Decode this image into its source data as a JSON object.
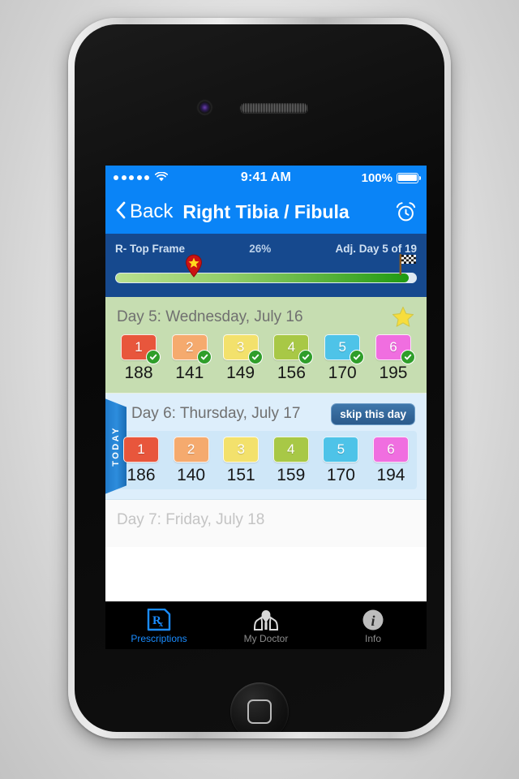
{
  "status_bar": {
    "signal_dots": 5,
    "wifi_icon": "wifi-icon",
    "time": "9:41 AM",
    "battery_percent": "100%",
    "battery_icon": "battery-full-icon"
  },
  "nav_bar": {
    "back_icon": "chevron-left-icon",
    "back_label": "Back",
    "title": "Right Tibia / Fibula",
    "alarm_icon": "alarm-clock-icon"
  },
  "progress": {
    "frame_label": "R- Top Frame",
    "percent": "26%",
    "day_label": "Adj. Day 5 of 19",
    "percent_value": 26,
    "pin_icon": "map-pin-star-icon",
    "finish_icon": "checkered-flag-icon",
    "track_color": "#dfe9f2",
    "fill_start_color": "#b9e08f",
    "fill_end_color": "#1f9a12",
    "panel_color": "#16498e"
  },
  "strut_colors": [
    "#e8563c",
    "#f5aa6e",
    "#f3e16c",
    "#a8c846",
    "#4ec3e8",
    "#f06ee0"
  ],
  "strut_labels": [
    "1",
    "2",
    "3",
    "4",
    "5",
    "6"
  ],
  "days": [
    {
      "title": "Day 5: Wednesday, July 16",
      "state": "done",
      "badge_icon": "star-icon",
      "values": [
        "188",
        "141",
        "149",
        "156",
        "170",
        "195"
      ],
      "checked": true,
      "background": "#c6ddb1"
    },
    {
      "title": "Day 6: Thursday, July 17",
      "state": "today",
      "ribbon_label": "TODAY",
      "skip_label": "skip this day",
      "values": [
        "186",
        "140",
        "151",
        "159",
        "170",
        "194"
      ],
      "checked": false,
      "background": "#ddeefb"
    },
    {
      "title": "Day 7: Friday, July 18",
      "state": "future",
      "values": [],
      "checked": false,
      "background": "#fafafa"
    }
  ],
  "tab_bar": {
    "items": [
      {
        "label": "Prescriptions",
        "icon": "rx-icon",
        "active": true
      },
      {
        "label": "My Doctor",
        "icon": "doctor-icon",
        "active": false
      },
      {
        "label": "Info",
        "icon": "info-circle-icon",
        "active": false
      }
    ],
    "active_color": "#1a8cff",
    "inactive_color": "#8c8c8c"
  }
}
